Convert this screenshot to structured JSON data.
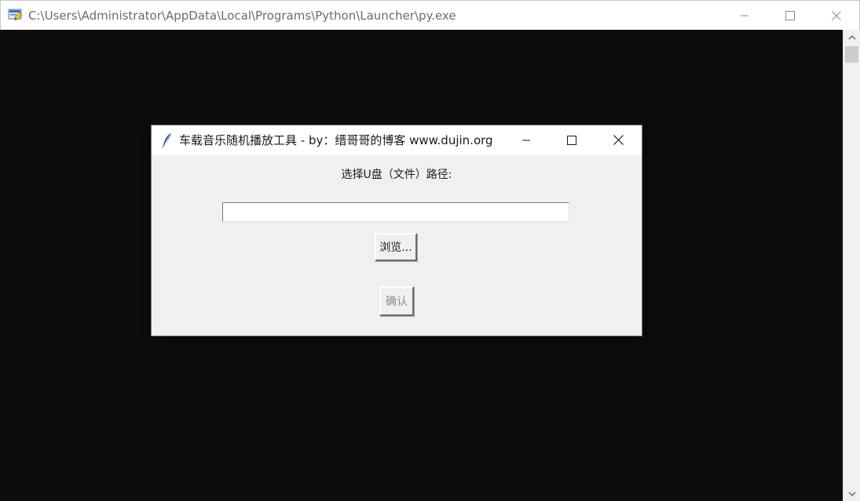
{
  "console": {
    "title": "C:\\Users\\Administrator\\AppData\\Local\\Programs\\Python\\Launcher\\py.exe",
    "icon": "python-launcher-icon",
    "minimize_icon": "minimize-icon",
    "maximize_icon": "maximize-icon",
    "close_icon": "close-icon"
  },
  "dialog": {
    "title": "车载音乐随机播放工具 - by：缙哥哥的博客 www.dujin.org",
    "icon": "tk-feather-icon",
    "label": "选择U盘（文件）路径:",
    "path_value": "",
    "browse_label": "浏览...",
    "confirm_label": "确认",
    "confirm_enabled": false
  },
  "colors": {
    "console_bg": "#0c0c0c",
    "dialog_bg": "#f0f0f0",
    "disabled_text": "#8a8a8a"
  }
}
